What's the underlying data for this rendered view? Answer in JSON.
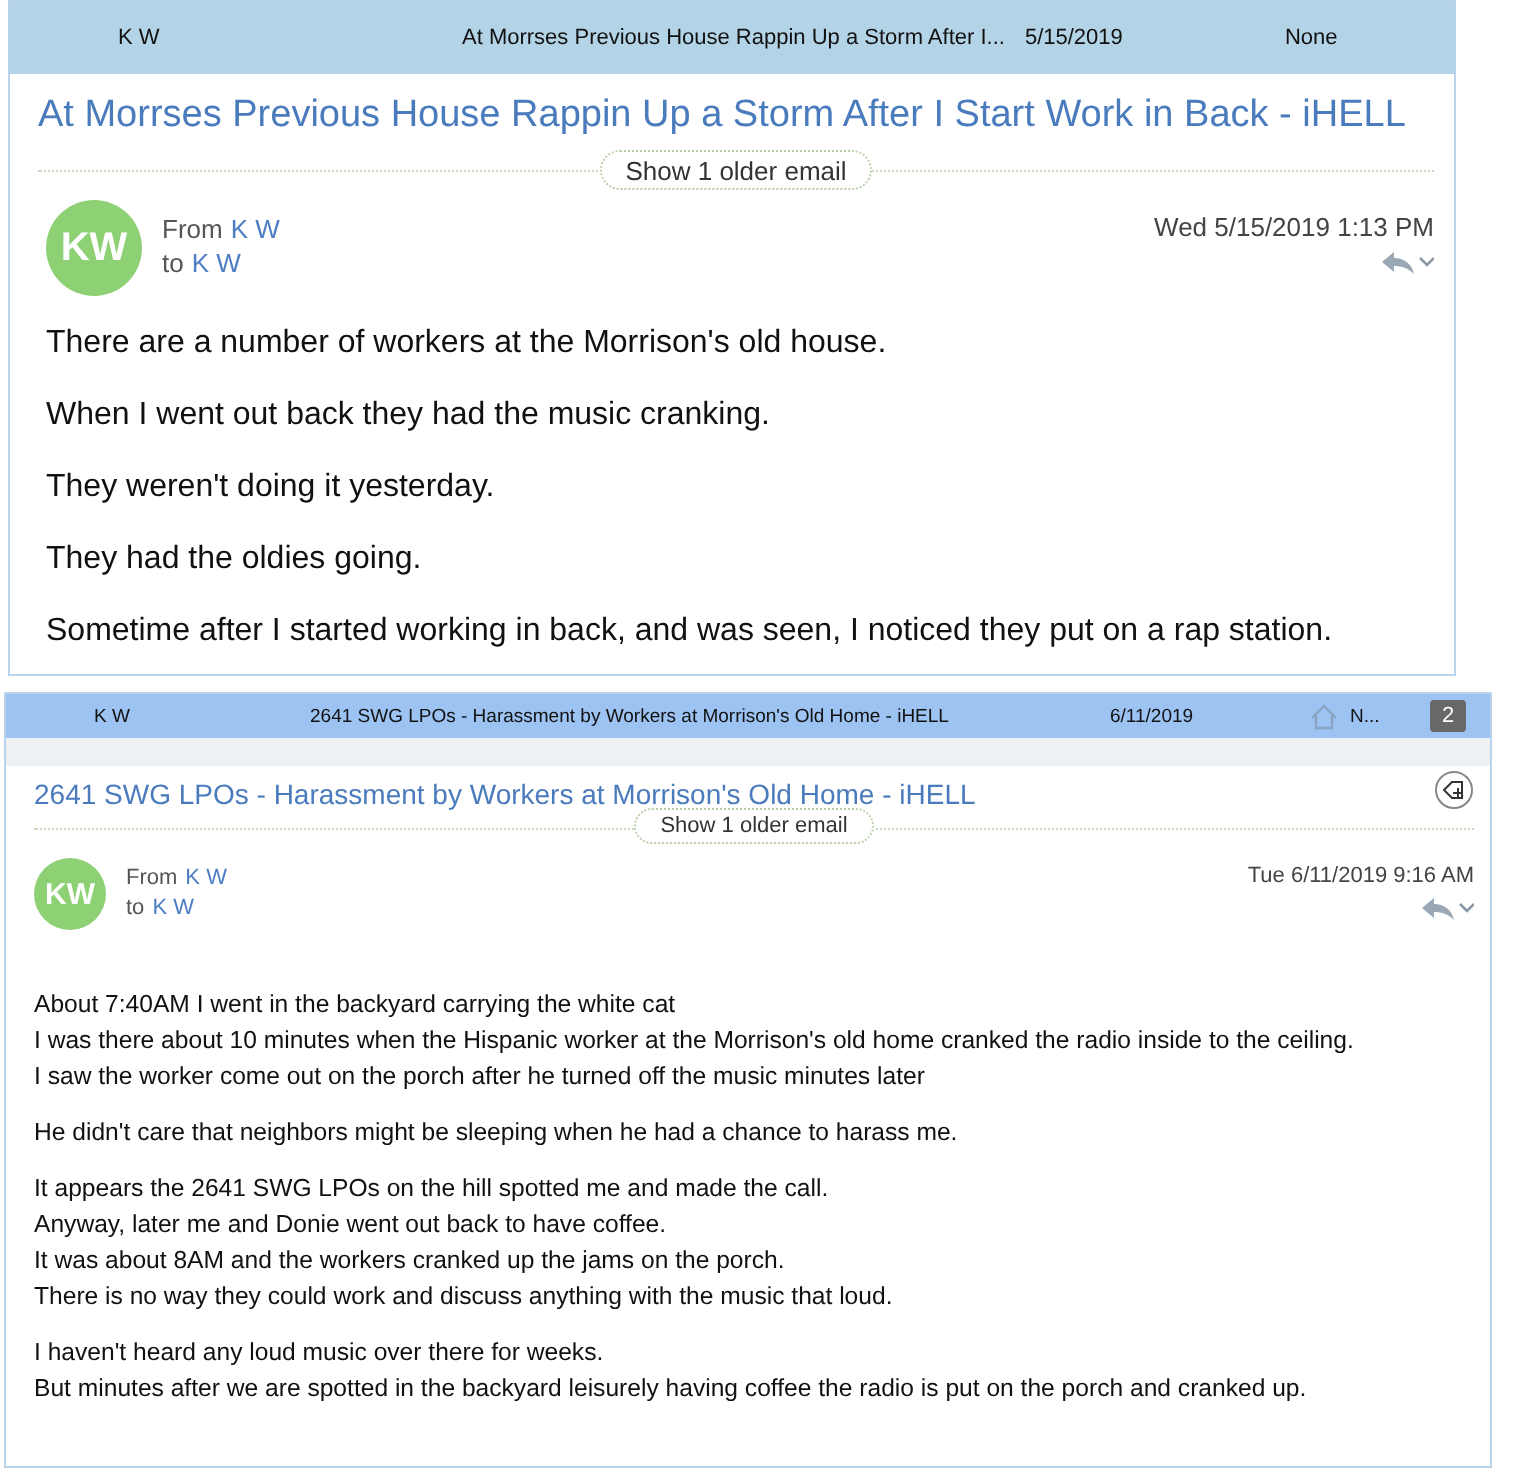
{
  "panels": [
    {
      "header": {
        "sender": "K W",
        "subject": "At Morrses Previous House Rappin Up a Storm After I...",
        "date": "5/15/2019",
        "category": "None",
        "selected": false
      },
      "title": "At Morrses Previous House Rappin Up a Storm After I Start Work in Back - iHELL",
      "older": "Show 1 older email",
      "avatar": "KW",
      "from_label": "From",
      "from": "K W",
      "to_label": "to",
      "to": "K W",
      "sent": "Wed 5/15/2019 1:13 PM",
      "paragraphs": [
        [
          "There are a number of workers at the Morrison's old house."
        ],
        [
          "When I went out back they had the music cranking."
        ],
        [
          "They weren't doing it yesterday."
        ],
        [
          "They had the oldies going."
        ],
        [
          "Sometime after I started working in back, and was seen, I noticed they put on a rap station."
        ]
      ]
    },
    {
      "header": {
        "sender": "K W",
        "subject": "2641 SWG LPOs - Harassment by Workers at Morrison's Old Home - iHELL",
        "date": "6/11/2019",
        "category": "N...",
        "badge": "2",
        "selected": true
      },
      "title": "2641 SWG LPOs - Harassment by Workers at Morrison's Old Home - iHELL",
      "older": "Show 1 older email",
      "avatar": "KW",
      "from_label": "From",
      "from": "K W",
      "to_label": "to",
      "to": "K W",
      "sent": "Tue 6/11/2019 9:16 AM",
      "paragraphs": [
        [
          "About 7:40AM I went in the backyard carrying the white cat",
          "I was there about 10 minutes when the Hispanic worker at the Morrison's old home cranked the radio inside to the ceiling.",
          "I saw the worker come out on the porch after he turned off the music minutes later"
        ],
        [
          "He didn't care that neighbors might be sleeping when he had a chance to harass me."
        ],
        [
          "It appears the 2641 SWG LPOs on the hill spotted me and made the call.",
          "Anyway, later me and Donie went out back to have coffee.",
          "It was about 8AM and the workers cranked up the jams on the porch.",
          "There is no way they could work and discuss anything with the music that loud."
        ],
        [
          "I haven't heard any loud music over there for weeks.",
          "But minutes after we are spotted in the backyard leisurely having coffee the radio is put on the porch and cranked up."
        ]
      ]
    }
  ]
}
